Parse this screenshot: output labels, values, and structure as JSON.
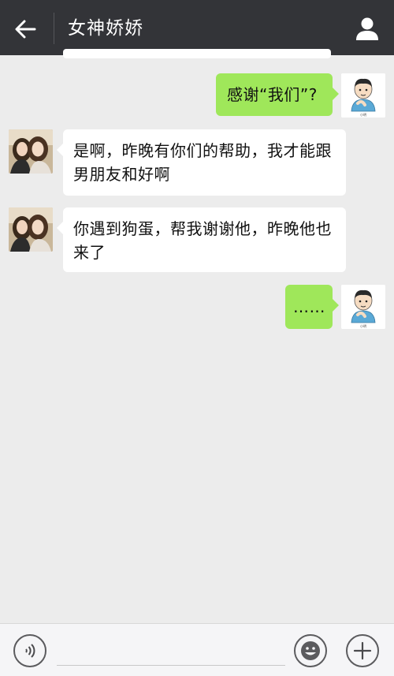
{
  "header": {
    "title": "女神娇娇",
    "back_icon": "arrow-left-icon",
    "profile_icon": "person-icon"
  },
  "messages": [
    {
      "side": "right",
      "text": "感谢“我们”?",
      "avatar": "cartoon-boy-avatar"
    },
    {
      "side": "left",
      "text": "是啊，昨晚有你们的帮助，我才能跟男朋友和好啊",
      "avatar": "girls-photo-avatar"
    },
    {
      "side": "left",
      "text": "你遇到狗蛋，帮我谢谢他，昨晚他也来了",
      "avatar": "girls-photo-avatar"
    },
    {
      "side": "right",
      "text": "……",
      "avatar": "cartoon-boy-avatar"
    }
  ],
  "bottom_bar": {
    "voice_icon": "voice-icon",
    "emoji_icon": "emoji-icon",
    "plus_icon": "plus-icon",
    "input_value": ""
  },
  "colors": {
    "header_bg": "#333438",
    "chat_bg": "#ececec",
    "right_bubble": "#9fe75a",
    "left_bubble": "#ffffff"
  }
}
